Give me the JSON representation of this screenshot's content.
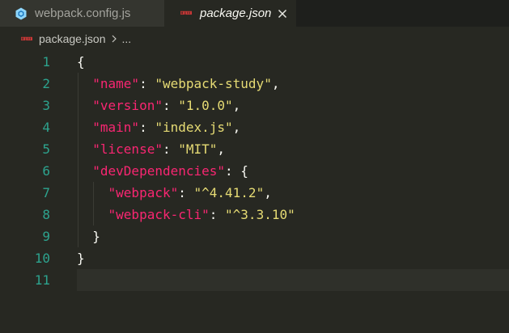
{
  "tabs": {
    "inactive_label": "webpack.config.js",
    "active_label": "package.json"
  },
  "breadcrumb": {
    "file": "package.json",
    "ellipsis": "..."
  },
  "editor": {
    "lines": [
      {
        "num": "1",
        "indent": "",
        "parts": [
          {
            "t": "p",
            "v": "{"
          }
        ]
      },
      {
        "num": "2",
        "indent": "  ",
        "parts": [
          {
            "t": "k",
            "v": "\"name\""
          },
          {
            "t": "p",
            "v": ": "
          },
          {
            "t": "s",
            "v": "\"webpack-study\""
          },
          {
            "t": "p",
            "v": ","
          }
        ]
      },
      {
        "num": "3",
        "indent": "  ",
        "parts": [
          {
            "t": "k",
            "v": "\"version\""
          },
          {
            "t": "p",
            "v": ": "
          },
          {
            "t": "s",
            "v": "\"1.0.0\""
          },
          {
            "t": "p",
            "v": ","
          }
        ]
      },
      {
        "num": "4",
        "indent": "  ",
        "parts": [
          {
            "t": "k",
            "v": "\"main\""
          },
          {
            "t": "p",
            "v": ": "
          },
          {
            "t": "s",
            "v": "\"index.js\""
          },
          {
            "t": "p",
            "v": ","
          }
        ]
      },
      {
        "num": "5",
        "indent": "  ",
        "parts": [
          {
            "t": "k",
            "v": "\"license\""
          },
          {
            "t": "p",
            "v": ": "
          },
          {
            "t": "s",
            "v": "\"MIT\""
          },
          {
            "t": "p",
            "v": ","
          }
        ]
      },
      {
        "num": "6",
        "indent": "  ",
        "parts": [
          {
            "t": "k",
            "v": "\"devDependencies\""
          },
          {
            "t": "p",
            "v": ": {"
          }
        ]
      },
      {
        "num": "7",
        "indent": "    ",
        "parts": [
          {
            "t": "k",
            "v": "\"webpack\""
          },
          {
            "t": "p",
            "v": ": "
          },
          {
            "t": "s",
            "v": "\"^4.41.2\""
          },
          {
            "t": "p",
            "v": ","
          }
        ]
      },
      {
        "num": "8",
        "indent": "    ",
        "parts": [
          {
            "t": "k",
            "v": "\"webpack-cli\""
          },
          {
            "t": "p",
            "v": ": "
          },
          {
            "t": "s",
            "v": "\"^3.3.10\""
          }
        ]
      },
      {
        "num": "9",
        "indent": "  ",
        "parts": [
          {
            "t": "p",
            "v": "}"
          }
        ]
      },
      {
        "num": "10",
        "indent": "",
        "parts": [
          {
            "t": "p",
            "v": "}"
          }
        ]
      },
      {
        "num": "11",
        "indent": "",
        "parts": []
      }
    ]
  },
  "colors": {
    "background": "#272822",
    "key": "#f92672",
    "string": "#e6db74",
    "line_number": "#2da38e",
    "npm_icon": "#cb3837"
  }
}
